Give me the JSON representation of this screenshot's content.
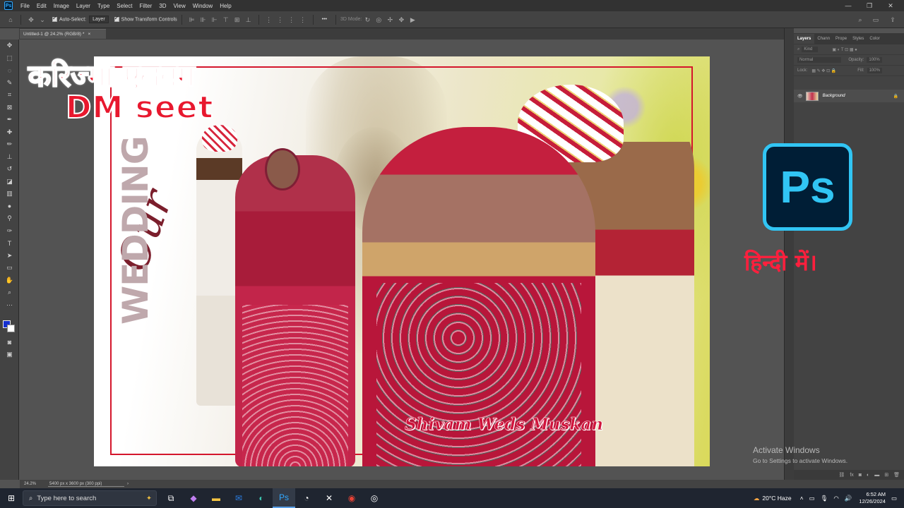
{
  "menu": [
    "File",
    "Edit",
    "Image",
    "Layer",
    "Type",
    "Select",
    "Filter",
    "3D",
    "View",
    "Window",
    "Help"
  ],
  "options": {
    "auto_select": "Auto-Select:",
    "layer_dropdown": "Layer",
    "transform_controls": "Show Transform Controls",
    "mode_3d": "3D Mode:",
    "more": "•••"
  },
  "document_tab": "Untitled-1 @ 24.2% (RGB/8) *",
  "document_tab_close": "×",
  "canvas": {
    "title_hindi": "करिज्मा एलबम",
    "title_dm": "DM seet",
    "our": "Our",
    "wedding": "WEDDING",
    "names": "Shivam Weds Muskan"
  },
  "overlay": {
    "ps_logo": "Ps",
    "hindi_label": "हिन्दी में।"
  },
  "layers_panel": {
    "tabs": [
      "Layers",
      "Chann",
      "Prope",
      "Styles",
      "Color"
    ],
    "kind_placeholder": "Kind",
    "blend_mode": "Normal",
    "opacity_label": "Opacity:",
    "opacity_value": "100%",
    "lock_label": "Lock:",
    "fill_label": "Fill:",
    "fill_value": "100%",
    "layer_name": "Background"
  },
  "activate": {
    "title": "Activate Windows",
    "sub": "Go to Settings to activate Windows."
  },
  "status": {
    "zoom": "24.2%",
    "dimensions": "5400 px x 3600 px (300 ppi)"
  },
  "taskbar": {
    "search_placeholder": "Type here to search",
    "weather": "20°C  Haze",
    "time": "6:52 AM",
    "date": "12/26/2024"
  },
  "colors": {
    "accent_red": "#e8182e",
    "ps_blue": "#31c5f4",
    "foreground_swatch": "#1530d0",
    "background_swatch": "#ffffff"
  }
}
